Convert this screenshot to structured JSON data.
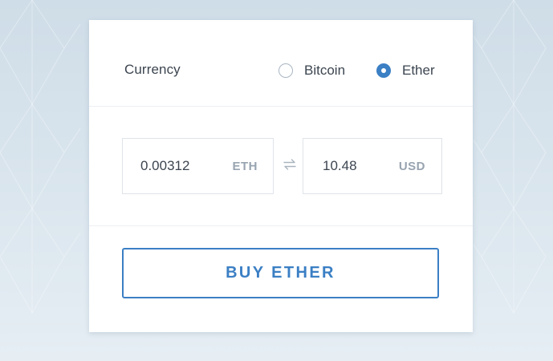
{
  "currency_section": {
    "label": "Currency",
    "options": [
      {
        "label": "Bitcoin",
        "selected": false
      },
      {
        "label": "Ether",
        "selected": true
      }
    ]
  },
  "amount_section": {
    "crypto": {
      "value": "0.00312",
      "unit": "ETH"
    },
    "fiat": {
      "value": "10.48",
      "unit": "USD"
    },
    "swap_icon": "swap-arrows-icon"
  },
  "action": {
    "buy_label": "BUY ETHER"
  },
  "colors": {
    "accent": "#3b7fc4",
    "text": "#3c4550",
    "muted": "#98a4b0",
    "background": "#d6e2eb"
  }
}
